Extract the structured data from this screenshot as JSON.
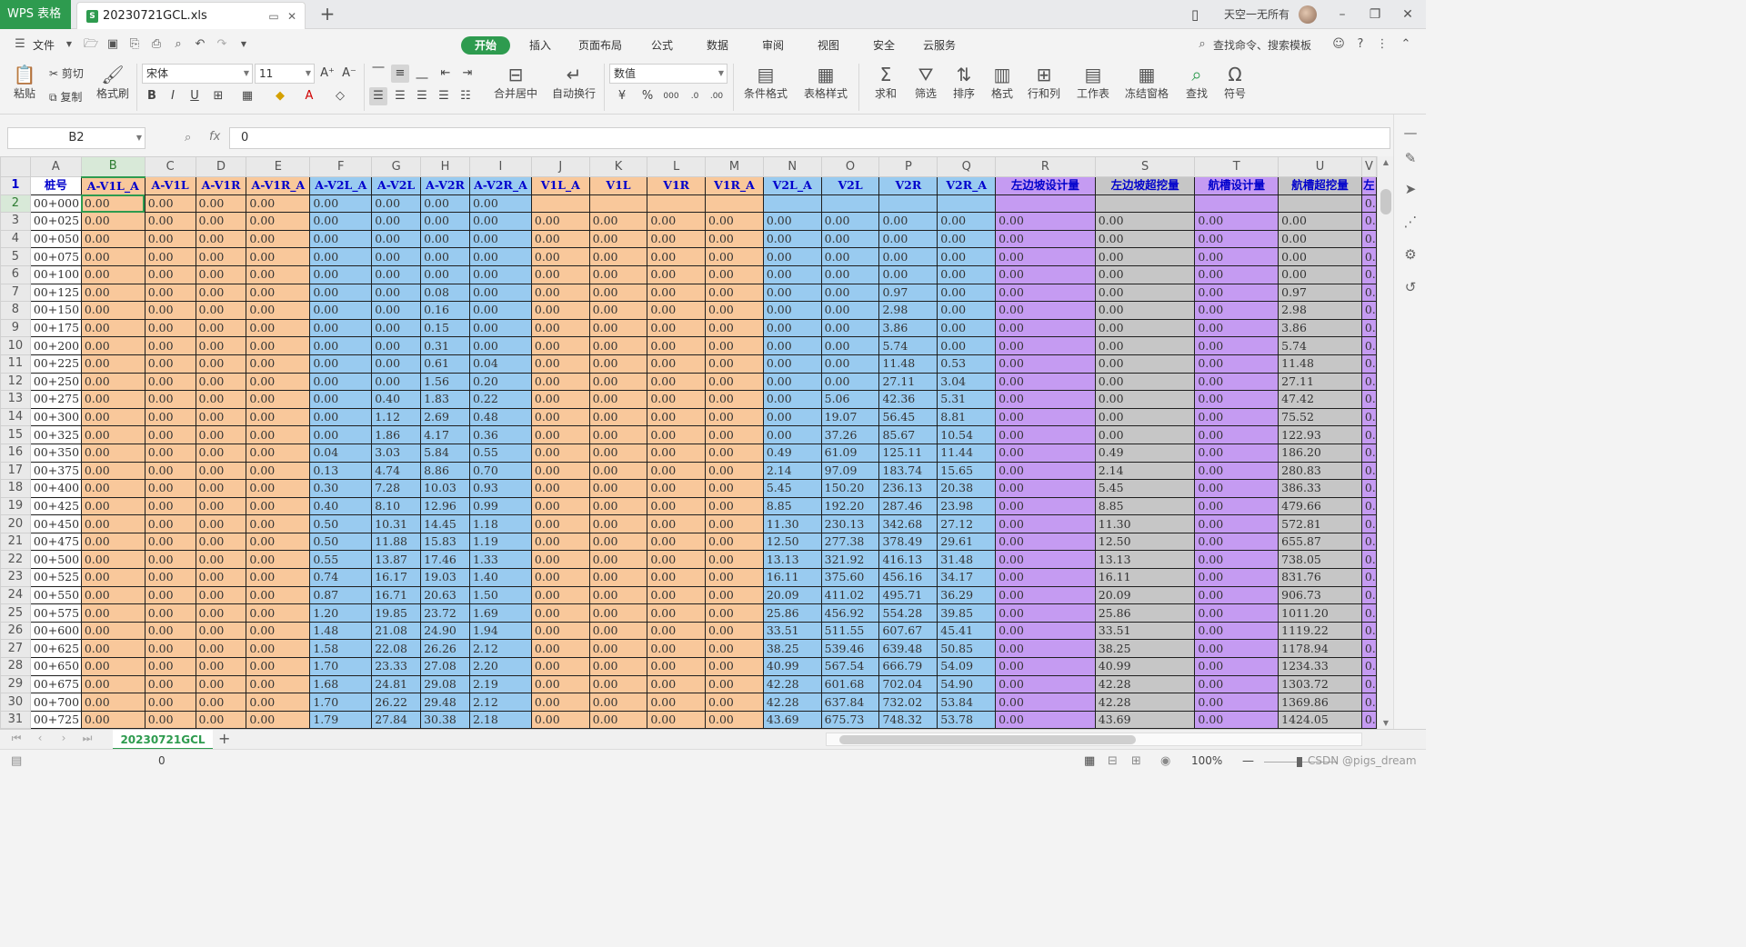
{
  "titlebar": {
    "app_brand": "WPS 表格",
    "file_icon": "S",
    "doc_name": "20230721GCL.xls",
    "user_label": "天空一无所有",
    "new_tab": "+"
  },
  "menubar": {
    "file_label": "文件",
    "tabs": [
      "开始",
      "插入",
      "页面布局",
      "公式",
      "数据",
      "审阅",
      "视图",
      "安全",
      "云服务"
    ],
    "active_tab": "开始",
    "search_placeholder": "查找命令、搜索模板"
  },
  "ribbon": {
    "paste": "粘贴",
    "cut": "剪切",
    "copy": "复制",
    "format_painter": "格式刷",
    "font_name": "宋体",
    "font_size": "11",
    "grow": "A⁺",
    "shrink": "A⁻",
    "bold": "B",
    "italic": "I",
    "underline": "U",
    "merge_center": "合并居中",
    "wrap_text": "自动换行",
    "number_format": "数值",
    "percent": "%",
    "cond_format": "条件格式",
    "table_style": "表格样式",
    "sum": "求和",
    "filter": "筛选",
    "sort": "排序",
    "format": "格式",
    "row_col": "行和列",
    "worksheet": "工作表",
    "freeze": "冻结窗格",
    "find": "查找",
    "symbol": "符号"
  },
  "formula_bar": {
    "name_box": "B2",
    "fx": "fx",
    "value": "0"
  },
  "colors": {
    "orange": "#f9c89b",
    "blue": "#99cbf0",
    "purple": "#c59bf2",
    "gray": "#c6c6c6",
    "white": "#ffffff",
    "header_text": "#0000cc",
    "accent": "#2e9b4f"
  },
  "grid": {
    "col_letters": [
      "A",
      "B",
      "C",
      "D",
      "E",
      "F",
      "G",
      "H",
      "I",
      "J",
      "K",
      "L",
      "M",
      "N",
      "O",
      "P",
      "Q",
      "R",
      "S",
      "T",
      "U",
      "V"
    ],
    "col_fill": [
      "white",
      "orange",
      "orange",
      "orange",
      "orange",
      "blue",
      "blue",
      "blue",
      "blue",
      "orange",
      "orange",
      "orange",
      "orange",
      "blue",
      "blue",
      "blue",
      "blue",
      "purple",
      "gray",
      "purple",
      "gray",
      "purple"
    ],
    "headers": [
      "桩号",
      "A-V1L_A",
      "A-V1L",
      "A-V1R",
      "A-V1R_A",
      "A-V2L_A",
      "A-V2L",
      "A-V2R",
      "A-V2R_A",
      "V1L_A",
      "V1L",
      "V1R",
      "V1R_A",
      "V2L_A",
      "V2L",
      "V2R",
      "V2R_A",
      "左边坡设计量",
      "左边坡超挖量",
      "航槽设计量",
      "航槽超挖量",
      "左"
    ],
    "row_numbers": [
      "1",
      "2",
      "3",
      "4",
      "5",
      "6",
      "7",
      "8",
      "9",
      "10",
      "11",
      "12",
      "13",
      "14",
      "15",
      "16",
      "17",
      "18",
      "19",
      "20",
      "21",
      "22",
      "23",
      "24",
      "25",
      "26",
      "27",
      "28",
      "29",
      "30",
      "31"
    ],
    "rows": [
      [
        "00+000",
        "0.00",
        "0.00",
        "0.00",
        "0.00",
        "0.00",
        "0.00",
        "0.00",
        "0.00",
        "",
        "",
        "",
        "",
        "",
        "",
        "",
        "",
        "",
        "",
        "",
        "",
        "0."
      ],
      [
        "00+025",
        "0.00",
        "0.00",
        "0.00",
        "0.00",
        "0.00",
        "0.00",
        "0.00",
        "0.00",
        "0.00",
        "0.00",
        "0.00",
        "0.00",
        "0.00",
        "0.00",
        "0.00",
        "0.00",
        "0.00",
        "0.00",
        "0.00",
        "0.00",
        "0."
      ],
      [
        "00+050",
        "0.00",
        "0.00",
        "0.00",
        "0.00",
        "0.00",
        "0.00",
        "0.00",
        "0.00",
        "0.00",
        "0.00",
        "0.00",
        "0.00",
        "0.00",
        "0.00",
        "0.00",
        "0.00",
        "0.00",
        "0.00",
        "0.00",
        "0.00",
        "0."
      ],
      [
        "00+075",
        "0.00",
        "0.00",
        "0.00",
        "0.00",
        "0.00",
        "0.00",
        "0.00",
        "0.00",
        "0.00",
        "0.00",
        "0.00",
        "0.00",
        "0.00",
        "0.00",
        "0.00",
        "0.00",
        "0.00",
        "0.00",
        "0.00",
        "0.00",
        "0."
      ],
      [
        "00+100",
        "0.00",
        "0.00",
        "0.00",
        "0.00",
        "0.00",
        "0.00",
        "0.00",
        "0.00",
        "0.00",
        "0.00",
        "0.00",
        "0.00",
        "0.00",
        "0.00",
        "0.00",
        "0.00",
        "0.00",
        "0.00",
        "0.00",
        "0.00",
        "0."
      ],
      [
        "00+125",
        "0.00",
        "0.00",
        "0.00",
        "0.00",
        "0.00",
        "0.00",
        "0.08",
        "0.00",
        "0.00",
        "0.00",
        "0.00",
        "0.00",
        "0.00",
        "0.00",
        "0.97",
        "0.00",
        "0.00",
        "0.00",
        "0.00",
        "0.97",
        "0."
      ],
      [
        "00+150",
        "0.00",
        "0.00",
        "0.00",
        "0.00",
        "0.00",
        "0.00",
        "0.16",
        "0.00",
        "0.00",
        "0.00",
        "0.00",
        "0.00",
        "0.00",
        "0.00",
        "2.98",
        "0.00",
        "0.00",
        "0.00",
        "0.00",
        "2.98",
        "0."
      ],
      [
        "00+175",
        "0.00",
        "0.00",
        "0.00",
        "0.00",
        "0.00",
        "0.00",
        "0.15",
        "0.00",
        "0.00",
        "0.00",
        "0.00",
        "0.00",
        "0.00",
        "0.00",
        "3.86",
        "0.00",
        "0.00",
        "0.00",
        "0.00",
        "3.86",
        "0."
      ],
      [
        "00+200",
        "0.00",
        "0.00",
        "0.00",
        "0.00",
        "0.00",
        "0.00",
        "0.31",
        "0.00",
        "0.00",
        "0.00",
        "0.00",
        "0.00",
        "0.00",
        "0.00",
        "5.74",
        "0.00",
        "0.00",
        "0.00",
        "0.00",
        "5.74",
        "0."
      ],
      [
        "00+225",
        "0.00",
        "0.00",
        "0.00",
        "0.00",
        "0.00",
        "0.00",
        "0.61",
        "0.04",
        "0.00",
        "0.00",
        "0.00",
        "0.00",
        "0.00",
        "0.00",
        "11.48",
        "0.53",
        "0.00",
        "0.00",
        "0.00",
        "11.48",
        "0."
      ],
      [
        "00+250",
        "0.00",
        "0.00",
        "0.00",
        "0.00",
        "0.00",
        "0.00",
        "1.56",
        "0.20",
        "0.00",
        "0.00",
        "0.00",
        "0.00",
        "0.00",
        "0.00",
        "27.11",
        "3.04",
        "0.00",
        "0.00",
        "0.00",
        "27.11",
        "0."
      ],
      [
        "00+275",
        "0.00",
        "0.00",
        "0.00",
        "0.00",
        "0.00",
        "0.40",
        "1.83",
        "0.22",
        "0.00",
        "0.00",
        "0.00",
        "0.00",
        "0.00",
        "5.06",
        "42.36",
        "5.31",
        "0.00",
        "0.00",
        "0.00",
        "47.42",
        "0."
      ],
      [
        "00+300",
        "0.00",
        "0.00",
        "0.00",
        "0.00",
        "0.00",
        "1.12",
        "2.69",
        "0.48",
        "0.00",
        "0.00",
        "0.00",
        "0.00",
        "0.00",
        "19.07",
        "56.45",
        "8.81",
        "0.00",
        "0.00",
        "0.00",
        "75.52",
        "0."
      ],
      [
        "00+325",
        "0.00",
        "0.00",
        "0.00",
        "0.00",
        "0.00",
        "1.86",
        "4.17",
        "0.36",
        "0.00",
        "0.00",
        "0.00",
        "0.00",
        "0.00",
        "37.26",
        "85.67",
        "10.54",
        "0.00",
        "0.00",
        "0.00",
        "122.93",
        "0."
      ],
      [
        "00+350",
        "0.00",
        "0.00",
        "0.00",
        "0.00",
        "0.04",
        "3.03",
        "5.84",
        "0.55",
        "0.00",
        "0.00",
        "0.00",
        "0.00",
        "0.49",
        "61.09",
        "125.11",
        "11.44",
        "0.00",
        "0.49",
        "0.00",
        "186.20",
        "0."
      ],
      [
        "00+375",
        "0.00",
        "0.00",
        "0.00",
        "0.00",
        "0.13",
        "4.74",
        "8.86",
        "0.70",
        "0.00",
        "0.00",
        "0.00",
        "0.00",
        "2.14",
        "97.09",
        "183.74",
        "15.65",
        "0.00",
        "2.14",
        "0.00",
        "280.83",
        "0."
      ],
      [
        "00+400",
        "0.00",
        "0.00",
        "0.00",
        "0.00",
        "0.30",
        "7.28",
        "10.03",
        "0.93",
        "0.00",
        "0.00",
        "0.00",
        "0.00",
        "5.45",
        "150.20",
        "236.13",
        "20.38",
        "0.00",
        "5.45",
        "0.00",
        "386.33",
        "0."
      ],
      [
        "00+425",
        "0.00",
        "0.00",
        "0.00",
        "0.00",
        "0.40",
        "8.10",
        "12.96",
        "0.99",
        "0.00",
        "0.00",
        "0.00",
        "0.00",
        "8.85",
        "192.20",
        "287.46",
        "23.98",
        "0.00",
        "8.85",
        "0.00",
        "479.66",
        "0."
      ],
      [
        "00+450",
        "0.00",
        "0.00",
        "0.00",
        "0.00",
        "0.50",
        "10.31",
        "14.45",
        "1.18",
        "0.00",
        "0.00",
        "0.00",
        "0.00",
        "11.30",
        "230.13",
        "342.68",
        "27.12",
        "0.00",
        "11.30",
        "0.00",
        "572.81",
        "0."
      ],
      [
        "00+475",
        "0.00",
        "0.00",
        "0.00",
        "0.00",
        "0.50",
        "11.88",
        "15.83",
        "1.19",
        "0.00",
        "0.00",
        "0.00",
        "0.00",
        "12.50",
        "277.38",
        "378.49",
        "29.61",
        "0.00",
        "12.50",
        "0.00",
        "655.87",
        "0."
      ],
      [
        "00+500",
        "0.00",
        "0.00",
        "0.00",
        "0.00",
        "0.55",
        "13.87",
        "17.46",
        "1.33",
        "0.00",
        "0.00",
        "0.00",
        "0.00",
        "13.13",
        "321.92",
        "416.13",
        "31.48",
        "0.00",
        "13.13",
        "0.00",
        "738.05",
        "0."
      ],
      [
        "00+525",
        "0.00",
        "0.00",
        "0.00",
        "0.00",
        "0.74",
        "16.17",
        "19.03",
        "1.40",
        "0.00",
        "0.00",
        "0.00",
        "0.00",
        "16.11",
        "375.60",
        "456.16",
        "34.17",
        "0.00",
        "16.11",
        "0.00",
        "831.76",
        "0."
      ],
      [
        "00+550",
        "0.00",
        "0.00",
        "0.00",
        "0.00",
        "0.87",
        "16.71",
        "20.63",
        "1.50",
        "0.00",
        "0.00",
        "0.00",
        "0.00",
        "20.09",
        "411.02",
        "495.71",
        "36.29",
        "0.00",
        "20.09",
        "0.00",
        "906.73",
        "0."
      ],
      [
        "00+575",
        "0.00",
        "0.00",
        "0.00",
        "0.00",
        "1.20",
        "19.85",
        "23.72",
        "1.69",
        "0.00",
        "0.00",
        "0.00",
        "0.00",
        "25.86",
        "456.92",
        "554.28",
        "39.85",
        "0.00",
        "25.86",
        "0.00",
        "1011.20",
        "0."
      ],
      [
        "00+600",
        "0.00",
        "0.00",
        "0.00",
        "0.00",
        "1.48",
        "21.08",
        "24.90",
        "1.94",
        "0.00",
        "0.00",
        "0.00",
        "0.00",
        "33.51",
        "511.55",
        "607.67",
        "45.41",
        "0.00",
        "33.51",
        "0.00",
        "1119.22",
        "0."
      ],
      [
        "00+625",
        "0.00",
        "0.00",
        "0.00",
        "0.00",
        "1.58",
        "22.08",
        "26.26",
        "2.12",
        "0.00",
        "0.00",
        "0.00",
        "0.00",
        "38.25",
        "539.46",
        "639.48",
        "50.85",
        "0.00",
        "38.25",
        "0.00",
        "1178.94",
        "0."
      ],
      [
        "00+650",
        "0.00",
        "0.00",
        "0.00",
        "0.00",
        "1.70",
        "23.33",
        "27.08",
        "2.20",
        "0.00",
        "0.00",
        "0.00",
        "0.00",
        "40.99",
        "567.54",
        "666.79",
        "54.09",
        "0.00",
        "40.99",
        "0.00",
        "1234.33",
        "0."
      ],
      [
        "00+675",
        "0.00",
        "0.00",
        "0.00",
        "0.00",
        "1.68",
        "24.81",
        "29.08",
        "2.19",
        "0.00",
        "0.00",
        "0.00",
        "0.00",
        "42.28",
        "601.68",
        "702.04",
        "54.90",
        "0.00",
        "42.28",
        "0.00",
        "1303.72",
        "0."
      ],
      [
        "00+700",
        "0.00",
        "0.00",
        "0.00",
        "0.00",
        "1.70",
        "26.22",
        "29.48",
        "2.12",
        "0.00",
        "0.00",
        "0.00",
        "0.00",
        "42.28",
        "637.84",
        "732.02",
        "53.84",
        "0.00",
        "42.28",
        "0.00",
        "1369.86",
        "0."
      ],
      [
        "00+725",
        "0.00",
        "0.00",
        "0.00",
        "0.00",
        "1.79",
        "27.84",
        "30.38",
        "2.18",
        "0.00",
        "0.00",
        "0.00",
        "0.00",
        "43.69",
        "675.73",
        "748.32",
        "53.78",
        "0.00",
        "43.69",
        "0.00",
        "1424.05",
        "0."
      ]
    ]
  },
  "sheet_tabs": {
    "active": "20230721GCL",
    "add": "+"
  },
  "statusbar": {
    "value": "0",
    "zoom": "100%",
    "watermark": "CSDN @pigs_dream"
  }
}
